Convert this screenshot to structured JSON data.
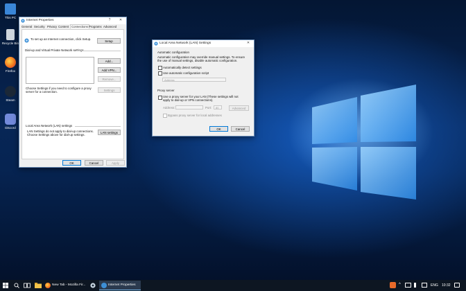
{
  "desktop_icons": [
    {
      "label": "This PC",
      "icon": "this-pc-icon"
    },
    {
      "label": "Recycle Bin",
      "icon": "recycle-bin-icon"
    },
    {
      "label": "Firefox",
      "icon": "firefox-icon"
    },
    {
      "label": "Steam",
      "icon": "steam-icon"
    },
    {
      "label": "Discord",
      "icon": "discord-icon"
    }
  ],
  "internet_properties": {
    "title": "Internet Properties",
    "help_btn": "?",
    "close_btn": "✕",
    "tabs": [
      "General",
      "Security",
      "Privacy",
      "Content",
      "Connections",
      "Programs",
      "Advanced"
    ],
    "setup_text": "To set up an Internet connection, click Setup.",
    "setup_btn": "Setup",
    "dialup_heading": "Dial-up and Virtual Private Network settings",
    "add_btn": "Add...",
    "add_vpn_btn": "Add VPN...",
    "remove_btn": "Remove...",
    "proxy_hint": "Choose Settings if you need to configure a proxy server for a connection.",
    "settings_btn": "Settings",
    "lan_heading": "Local Area Network (LAN) settings",
    "lan_text": "LAN Settings do not apply to dial-up connections. Choose Settings above for dial-up settings.",
    "lan_btn": "LAN settings",
    "ok_btn": "OK",
    "cancel_btn": "Cancel",
    "apply_btn": "Apply"
  },
  "lan_dialog": {
    "title": "Local Area Network (LAN) Settings",
    "close_btn": "✕",
    "auto_heading": "Automatic configuration",
    "auto_text": "Automatic configuration may override manual settings. To ensure the use of manual settings, disable automatic configuration.",
    "auto_detect": "Automatically detect settings",
    "use_script": "Use automatic configuration script",
    "address_placeholder": "Address",
    "proxy_heading": "Proxy server",
    "use_proxy": "Use a proxy server for your LAN (These settings will not apply to dial-up or VPN connections).",
    "proxy_address_label": "Address:",
    "port_label": "Port:",
    "port_value": "80",
    "advanced_btn": "Advanced",
    "bypass": "Bypass proxy server for local addresses",
    "ok_btn": "OK",
    "cancel_btn": "Cancel"
  },
  "taskbar": {
    "tasks": [
      {
        "label": "New Tab - Mozilla Fir...",
        "icon": "firefox-icon"
      },
      {
        "label": "Internet Properties",
        "icon": "internet-options-icon"
      }
    ],
    "lang": "ENG",
    "time": "10:32"
  }
}
